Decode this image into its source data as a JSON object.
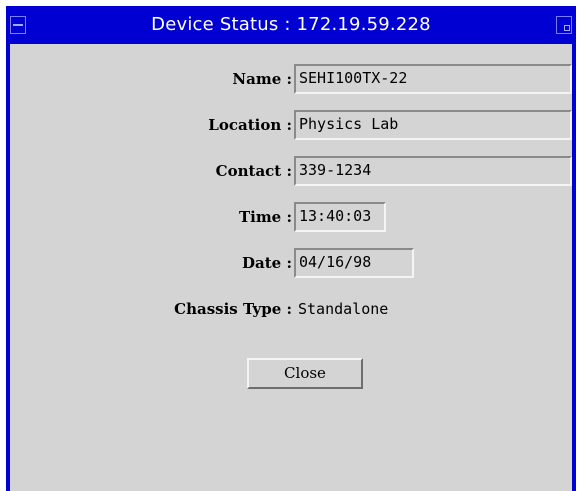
{
  "window": {
    "title": "Device Status : 172.19.59.228",
    "menu_icon": "window-menu-icon",
    "maximize_icon": "window-maximize-icon"
  },
  "fields": {
    "name": {
      "label": "Name :",
      "value": "SEHI100TX-22"
    },
    "location": {
      "label": "Location :",
      "value": "Physics Lab"
    },
    "contact": {
      "label": "Contact :",
      "value": "339-1234"
    },
    "time": {
      "label": "Time :",
      "value": "13:40:03"
    },
    "date": {
      "label": "Date :",
      "value": "04/16/98"
    },
    "chassis_type": {
      "label": "Chassis Type :",
      "value": "Standalone"
    }
  },
  "buttons": {
    "close_label": "Close"
  },
  "colors": {
    "titlebar": "#0000d2",
    "background": "#d4d4d4",
    "title_text": "#ffffff"
  }
}
